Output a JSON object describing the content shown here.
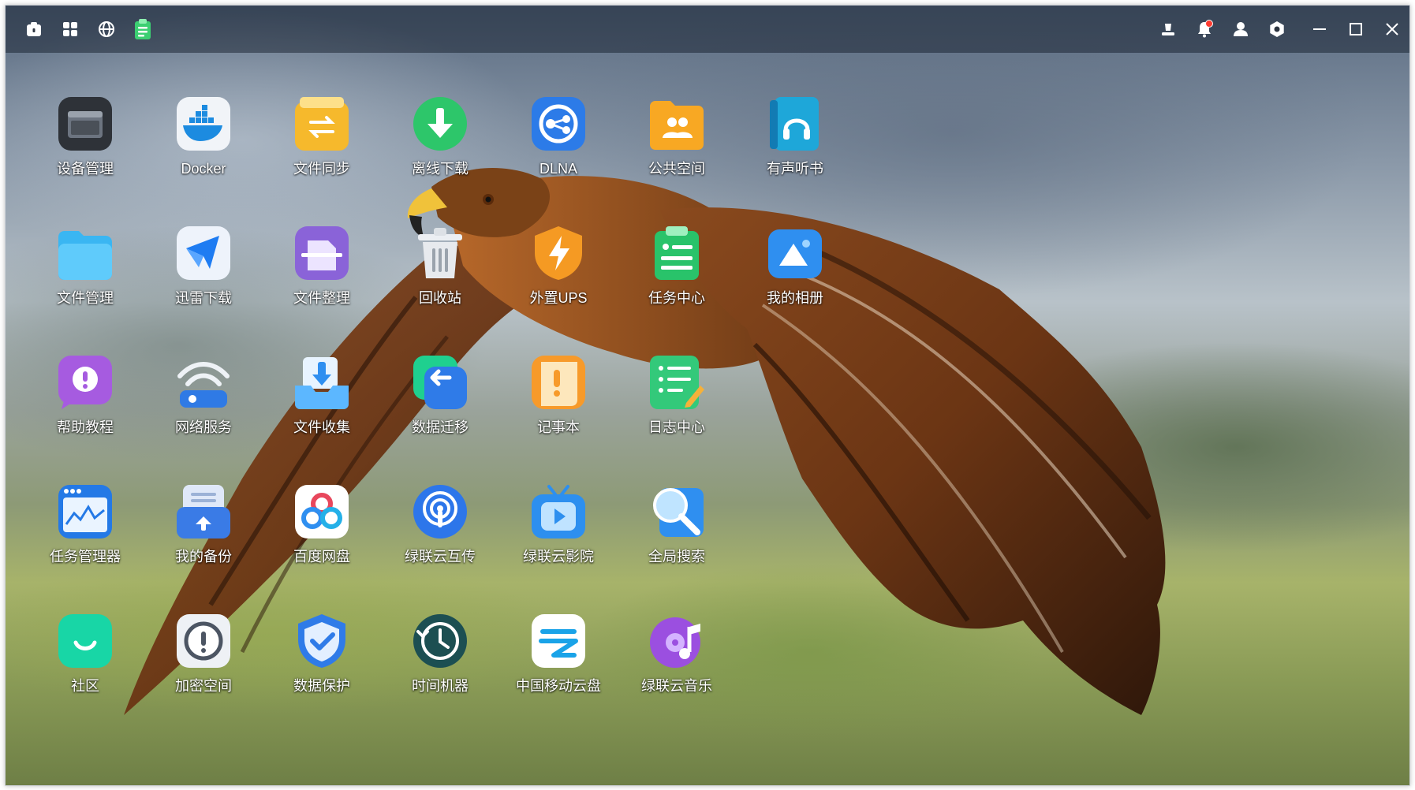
{
  "topbar": {
    "left_icons": [
      "home-icon",
      "app-grid-icon",
      "globe-icon",
      "task-clipboard-icon"
    ],
    "right_icons": [
      "upload-queue-icon",
      "bell-icon",
      "user-icon",
      "settings-icon"
    ],
    "notification_dot": true,
    "window_controls": [
      "minimize-icon",
      "maximize-icon",
      "close-icon"
    ]
  },
  "wallpaper": {
    "description": ""
  },
  "apps": [
    {
      "label": "设备管理",
      "icon": "device-manager-icon"
    },
    {
      "label": "Docker",
      "icon": "docker-icon"
    },
    {
      "label": "文件同步",
      "icon": "file-sync-icon"
    },
    {
      "label": "离线下载",
      "icon": "offline-download-icon"
    },
    {
      "label": "DLNA",
      "icon": "dlna-icon"
    },
    {
      "label": "公共空间",
      "icon": "public-space-icon"
    },
    {
      "label": "有声听书",
      "icon": "audiobook-icon"
    },
    {
      "label": "文件管理",
      "icon": "file-manager-icon"
    },
    {
      "label": "迅雷下载",
      "icon": "xunlei-download-icon"
    },
    {
      "label": "文件整理",
      "icon": "file-organize-icon"
    },
    {
      "label": "回收站",
      "icon": "recycle-bin-icon"
    },
    {
      "label": "外置UPS",
      "icon": "external-ups-icon"
    },
    {
      "label": "任务中心",
      "icon": "task-center-icon"
    },
    {
      "label": "我的相册",
      "icon": "my-album-icon"
    },
    {
      "label": "帮助教程",
      "icon": "help-tutorial-icon"
    },
    {
      "label": "网络服务",
      "icon": "network-service-icon"
    },
    {
      "label": "文件收集",
      "icon": "file-collect-icon"
    },
    {
      "label": "数据迁移",
      "icon": "data-migration-icon"
    },
    {
      "label": "记事本",
      "icon": "notepad-icon"
    },
    {
      "label": "日志中心",
      "icon": "log-center-icon"
    },
    {
      "label": "任务管理器",
      "icon": "task-manager-icon"
    },
    {
      "label": "我的备份",
      "icon": "my-backup-icon"
    },
    {
      "label": "百度网盘",
      "icon": "baidu-netdisk-icon"
    },
    {
      "label": "绿联云互传",
      "icon": "ugreen-transfer-icon"
    },
    {
      "label": "绿联云影院",
      "icon": "ugreen-cinema-icon"
    },
    {
      "label": "全局搜索",
      "icon": "global-search-icon"
    },
    {
      "label": "社区",
      "icon": "community-icon"
    },
    {
      "label": "加密空间",
      "icon": "encrypted-space-icon"
    },
    {
      "label": "数据保护",
      "icon": "data-protection-icon"
    },
    {
      "label": "时间机器",
      "icon": "time-machine-icon"
    },
    {
      "label": "中国移动云盘",
      "icon": "china-mobile-cloud-icon"
    },
    {
      "label": "绿联云音乐",
      "icon": "ugreen-music-icon"
    }
  ]
}
